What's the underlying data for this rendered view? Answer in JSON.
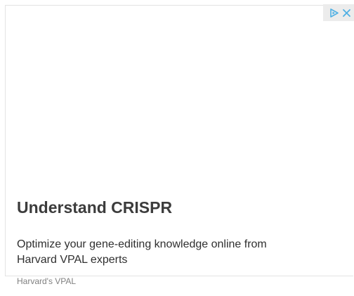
{
  "ad": {
    "headline": "Understand CRISPR",
    "description": "Optimize your gene-editing knowledge online from Harvard VPAL experts",
    "advertiser": "Harvard's VPAL",
    "badge_icons": [
      "adchoices-icon",
      "close-icon"
    ],
    "colors": {
      "badge_icon": "#4fb0e4",
      "headline": "#3c3c3c",
      "body": "#2f2f2f",
      "advertiser": "#808080"
    }
  }
}
